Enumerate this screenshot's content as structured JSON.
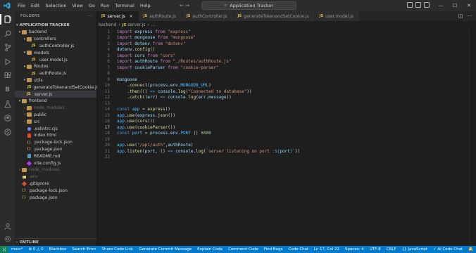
{
  "titlebar": {
    "menu": [
      "File",
      "Edit",
      "Selection",
      "View",
      "Go",
      "Run",
      "Terminal",
      "Help"
    ],
    "search_text": "Application Tracker",
    "nav_arrows": "← →",
    "window_controls": [
      "—",
      "☐",
      "✕"
    ]
  },
  "activitybar": {
    "icons": [
      "explorer-icon",
      "search-icon",
      "source-control-icon",
      "run-debug-icon",
      "extensions-icon",
      "blackbox-icon",
      "testing-icon",
      "github-icon",
      "remote-icon"
    ],
    "bottom_icons": [
      "account-icon",
      "settings-icon"
    ]
  },
  "sidebar": {
    "header": "FOLDERS",
    "more": "···",
    "section": "APPLICATION TRACKER",
    "tree": [
      {
        "label": "backend",
        "type": "folder",
        "depth": 0,
        "open": true
      },
      {
        "label": "controllers",
        "type": "folder",
        "depth": 1,
        "open": true
      },
      {
        "label": "authController.js",
        "type": "js",
        "depth": 2
      },
      {
        "label": "models",
        "type": "folder",
        "depth": 1,
        "open": true
      },
      {
        "label": "user.model.js",
        "type": "js",
        "depth": 2
      },
      {
        "label": "Routes",
        "type": "folder",
        "depth": 1,
        "open": true
      },
      {
        "label": "authRoute.js",
        "type": "js",
        "depth": 2
      },
      {
        "label": "utils",
        "type": "folder",
        "depth": 1,
        "open": true
      },
      {
        "label": "generateTokenandSetCookie.js",
        "type": "js",
        "depth": 2
      },
      {
        "label": "server.js",
        "type": "js",
        "depth": 1,
        "selected": true
      },
      {
        "label": "frontend",
        "type": "folder",
        "depth": 0,
        "open": true
      },
      {
        "label": "node_modules",
        "type": "folder",
        "depth": 1,
        "open": false,
        "dim": true
      },
      {
        "label": "public",
        "type": "folder",
        "depth": 1,
        "open": false
      },
      {
        "label": "src",
        "type": "folder",
        "depth": 1,
        "open": false
      },
      {
        "label": ".eslintrc.cjs",
        "type": "eslint",
        "depth": 1
      },
      {
        "label": "index.html",
        "type": "html",
        "depth": 1
      },
      {
        "label": "package-lock.json",
        "type": "json",
        "depth": 1
      },
      {
        "label": "package.json",
        "type": "json",
        "depth": 1
      },
      {
        "label": "README.md",
        "type": "md",
        "depth": 1
      },
      {
        "label": "vite.config.js",
        "type": "vite",
        "depth": 1
      },
      {
        "label": "node_modules",
        "type": "folder",
        "depth": 0,
        "open": false,
        "dim": true
      },
      {
        "label": ".env",
        "type": "env",
        "depth": 0,
        "dim": true
      },
      {
        "label": ".gitignore",
        "type": "git",
        "depth": 0
      },
      {
        "label": "package-lock.json",
        "type": "json",
        "depth": 0
      },
      {
        "label": "package.json",
        "type": "json",
        "depth": 0
      }
    ],
    "outline": "OUTLINE"
  },
  "tabs": [
    {
      "label": "server.js",
      "active": true
    },
    {
      "label": "authRoute.js",
      "active": false
    },
    {
      "label": "authController.js",
      "active": false
    },
    {
      "label": "generateTokenandSetCookie.js",
      "active": false
    },
    {
      "label": "user.model.js",
      "active": false
    }
  ],
  "breadcrumb": [
    "backend",
    "server.js",
    "..."
  ],
  "editor": {
    "current_line": 17,
    "lines": [
      {
        "n": "1",
        "tokens": [
          [
            "kw",
            "import "
          ],
          [
            "var",
            "express "
          ],
          [
            "kw",
            "from "
          ],
          [
            "str",
            "\"express\""
          ]
        ]
      },
      {
        "n": "2",
        "tokens": [
          [
            "kw",
            "import "
          ],
          [
            "var",
            "mongoose "
          ],
          [
            "kw",
            "from "
          ],
          [
            "str",
            "\"mongoose\""
          ]
        ]
      },
      {
        "n": "3",
        "tokens": [
          [
            "kw",
            "import "
          ],
          [
            "var",
            "dotenv "
          ],
          [
            "kw",
            "from "
          ],
          [
            "str",
            "\"dotenv\""
          ]
        ]
      },
      {
        "n": "4",
        "tokens": [
          [
            "var",
            "dotenv"
          ],
          [
            "plain",
            "."
          ],
          [
            "fn",
            "config"
          ],
          [
            "plain",
            "()"
          ]
        ]
      },
      {
        "n": "5",
        "tokens": [
          [
            "kw",
            "import "
          ],
          [
            "var",
            "cors "
          ],
          [
            "kw",
            "from "
          ],
          [
            "str",
            "\"cors\""
          ]
        ]
      },
      {
        "n": "6",
        "tokens": [
          [
            "kw",
            "import "
          ],
          [
            "var",
            "authRoute "
          ],
          [
            "kw",
            "from "
          ],
          [
            "str",
            "\"./Routes/authRoute.js\""
          ]
        ]
      },
      {
        "n": "7",
        "tokens": [
          [
            "kw",
            "import "
          ],
          [
            "var",
            "cookieParser "
          ],
          [
            "kw",
            "from "
          ],
          [
            "str",
            "\"cookie-parser\""
          ]
        ]
      },
      {
        "n": "8",
        "tokens": []
      },
      {
        "n": "9",
        "tokens": [
          [
            "var",
            "mongoose"
          ]
        ]
      },
      {
        "n": "10",
        "tokens": [
          [
            "plain",
            "    ."
          ],
          [
            "fn",
            "connect"
          ],
          [
            "plain",
            "("
          ],
          [
            "var",
            "process"
          ],
          [
            "plain",
            "."
          ],
          [
            "var",
            "env"
          ],
          [
            "plain",
            "."
          ],
          [
            "const",
            "MONGODB_URL"
          ],
          [
            "plain",
            ")"
          ]
        ]
      },
      {
        "n": "11",
        "tokens": [
          [
            "plain",
            "    ."
          ],
          [
            "fn",
            "then"
          ],
          [
            "plain",
            "(() "
          ],
          [
            "type",
            "=>"
          ],
          [
            "plain",
            " "
          ],
          [
            "var",
            "console"
          ],
          [
            "plain",
            "."
          ],
          [
            "fn",
            "log"
          ],
          [
            "plain",
            "("
          ],
          [
            "str",
            "\"Connected to database\""
          ],
          [
            "plain",
            "))"
          ]
        ]
      },
      {
        "n": "12",
        "tokens": [
          [
            "plain",
            "    ."
          ],
          [
            "fn",
            "catch"
          ],
          [
            "plain",
            "(("
          ],
          [
            "var",
            "err"
          ],
          [
            "plain",
            ") "
          ],
          [
            "type",
            "=>"
          ],
          [
            "plain",
            " "
          ],
          [
            "var",
            "console"
          ],
          [
            "plain",
            "."
          ],
          [
            "fn",
            "log"
          ],
          [
            "plain",
            "("
          ],
          [
            "var",
            "err"
          ],
          [
            "plain",
            "."
          ],
          [
            "var",
            "message"
          ],
          [
            "plain",
            "))"
          ]
        ]
      },
      {
        "n": "13",
        "tokens": []
      },
      {
        "n": "14",
        "tokens": [
          [
            "type",
            "const "
          ],
          [
            "const",
            "app "
          ],
          [
            "plain",
            "= "
          ],
          [
            "fn",
            "express"
          ],
          [
            "plain",
            "()"
          ]
        ]
      },
      {
        "n": "15",
        "tokens": [
          [
            "const",
            "app"
          ],
          [
            "plain",
            "."
          ],
          [
            "fn",
            "use"
          ],
          [
            "plain",
            "("
          ],
          [
            "var",
            "express"
          ],
          [
            "plain",
            "."
          ],
          [
            "fn",
            "json"
          ],
          [
            "plain",
            "())"
          ]
        ]
      },
      {
        "n": "16",
        "tokens": [
          [
            "const",
            "app"
          ],
          [
            "plain",
            "."
          ],
          [
            "fn",
            "use"
          ],
          [
            "plain",
            "("
          ],
          [
            "fn",
            "cors"
          ],
          [
            "plain",
            "())"
          ]
        ]
      },
      {
        "n": "17",
        "tokens": [
          [
            "const",
            "app"
          ],
          [
            "plain",
            "."
          ],
          [
            "fn",
            "use"
          ],
          [
            "plain",
            "("
          ],
          [
            "fn",
            "cookieParser"
          ],
          [
            "plain",
            "())"
          ]
        ]
      },
      {
        "n": "18",
        "tokens": [
          [
            "type",
            "const "
          ],
          [
            "const",
            "port "
          ],
          [
            "plain",
            "= "
          ],
          [
            "var",
            "process"
          ],
          [
            "plain",
            "."
          ],
          [
            "var",
            "env"
          ],
          [
            "plain",
            "."
          ],
          [
            "const",
            "PORT "
          ],
          [
            "plain",
            "|| "
          ],
          [
            "num",
            "5000"
          ]
        ]
      },
      {
        "n": "19",
        "tokens": []
      },
      {
        "n": "20",
        "tokens": [
          [
            "const",
            "app"
          ],
          [
            "plain",
            "."
          ],
          [
            "fn",
            "use"
          ],
          [
            "plain",
            "("
          ],
          [
            "str",
            "\"/api/auth\""
          ],
          [
            "plain",
            ","
          ],
          [
            "var",
            "authRoute"
          ],
          [
            "plain",
            ")"
          ]
        ]
      },
      {
        "n": "21",
        "tokens": [
          [
            "const",
            "app"
          ],
          [
            "plain",
            "."
          ],
          [
            "fn",
            "listen"
          ],
          [
            "plain",
            "("
          ],
          [
            "var",
            "port"
          ],
          [
            "plain",
            ", () "
          ],
          [
            "type",
            "=>"
          ],
          [
            "plain",
            " "
          ],
          [
            "var",
            "console"
          ],
          [
            "plain",
            "."
          ],
          [
            "fn",
            "log"
          ],
          [
            "plain",
            "("
          ],
          [
            "str",
            "`server listening on port :"
          ],
          [
            "type",
            "${"
          ],
          [
            "var",
            "port"
          ],
          [
            "type",
            "}"
          ],
          [
            "str",
            "`"
          ],
          [
            "plain",
            "))"
          ]
        ]
      },
      {
        "n": "22",
        "tokens": []
      }
    ]
  },
  "statusbar": {
    "left": [
      "main*",
      "⊗ 0 △ 0",
      "Blackbox",
      "Search Error",
      "Share Code Link",
      "Generate Commit Message",
      "Explain Code",
      "Comment Code",
      "Find Bugs",
      "Code Chat"
    ],
    "right": [
      "Ln 17, Col 22",
      "Spaces: 4",
      "UTF-8",
      "CRLF",
      "{} JavaScript",
      "✓ AI Code Chat",
      "🔔"
    ]
  },
  "colors": {
    "accent": "#007acc",
    "editor_bg": "#1e1e1e",
    "sidebar_bg": "#252526",
    "keyword": "#c586c0",
    "string": "#ce9178",
    "function": "#dcdcaa"
  }
}
